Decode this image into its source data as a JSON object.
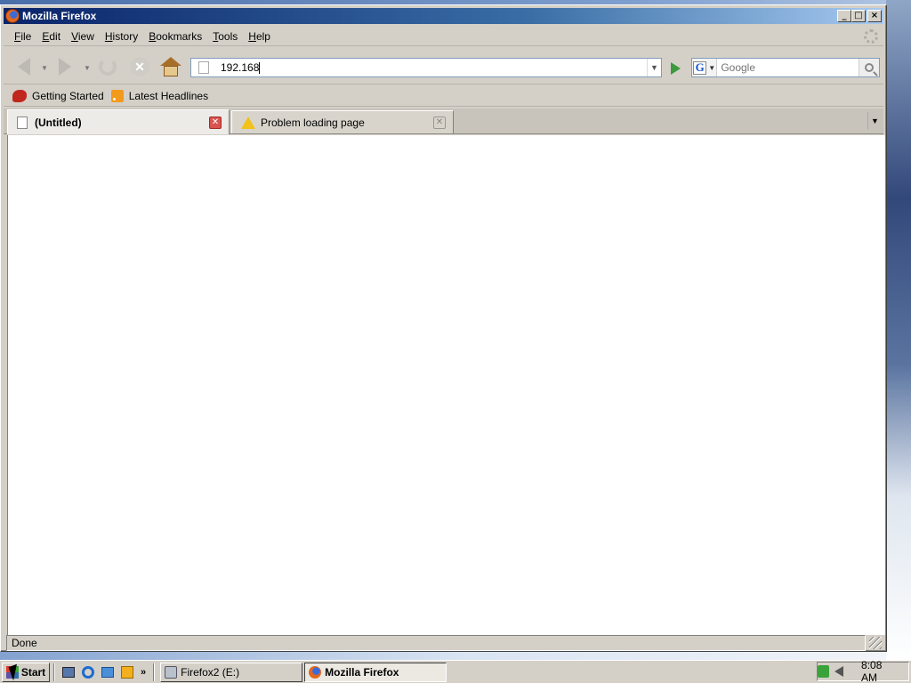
{
  "window": {
    "title": "Mozilla Firefox",
    "buttons": {
      "minimize": "_",
      "maximize": "□",
      "close": "×"
    }
  },
  "menubar": {
    "items": [
      {
        "label": "File",
        "accel": "F",
        "rest": "ile"
      },
      {
        "label": "Edit",
        "accel": "E",
        "rest": "dit"
      },
      {
        "label": "View",
        "accel": "V",
        "rest": "iew"
      },
      {
        "label": "History",
        "accel": "H",
        "rest": "istory"
      },
      {
        "label": "Bookmarks",
        "accel": "B",
        "rest": "ookmarks"
      },
      {
        "label": "Tools",
        "accel": "T",
        "rest": "ools"
      },
      {
        "label": "Help",
        "accel": "H",
        "rest": "elp"
      }
    ]
  },
  "navbar": {
    "url": "192.168",
    "search_placeholder": "Google",
    "search_engine": "G",
    "icons": {
      "back": "back-arrow-icon",
      "forward": "forward-arrow-icon",
      "reload": "reload-icon",
      "stop": "stop-icon",
      "home": "home-icon",
      "go": "go-arrow-icon",
      "search": "magnifier-icon"
    }
  },
  "bookmarks": {
    "items": [
      {
        "label": "Getting Started",
        "icon": "firefox-bookmark-icon"
      },
      {
        "label": "Latest Headlines",
        "icon": "rss-feed-icon"
      }
    ]
  },
  "tabs": [
    {
      "label": "(Untitled)",
      "active": true,
      "icon": "blank-page-icon",
      "close_color": "#d9534f"
    },
    {
      "label": "Problem loading page",
      "active": false,
      "icon": "warning-icon"
    }
  ],
  "status": {
    "text": "Done"
  },
  "taskbar": {
    "start_label": "Start",
    "more": "»",
    "tasks": [
      {
        "label": "Firefox2 (E:)",
        "icon": "drive-icon",
        "active": false
      },
      {
        "label": "Mozilla Firefox",
        "icon": "firefox-icon",
        "active": true
      }
    ],
    "clock": "8:08 AM"
  },
  "colors": {
    "title_gradient_start": "#0a246a",
    "title_gradient_end": "#a6caf0",
    "chrome_bg": "#d4d0c8",
    "content_bg": "#ffffff"
  }
}
